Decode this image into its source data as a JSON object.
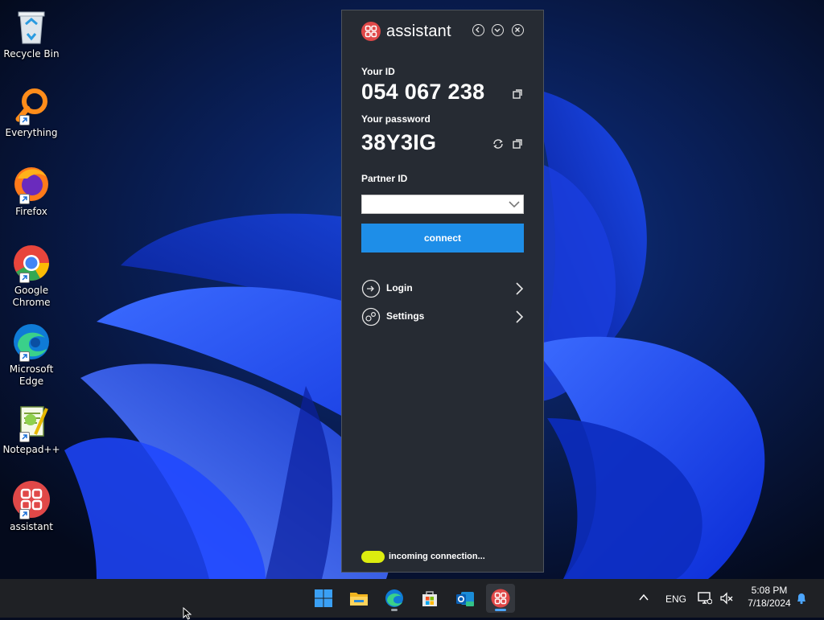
{
  "desktop": {
    "icons": [
      {
        "label": "Recycle Bin",
        "icon": "recycle-bin-icon"
      },
      {
        "label": "Everything",
        "icon": "everything-search-icon"
      },
      {
        "label": "Firefox",
        "icon": "firefox-icon"
      },
      {
        "label": "Google Chrome",
        "icon": "chrome-icon"
      },
      {
        "label": "Microsoft Edge",
        "icon": "edge-icon"
      },
      {
        "label": "Notepad++",
        "icon": "notepad-plus-plus-icon"
      },
      {
        "label": "assistant",
        "icon": "assistant-icon"
      }
    ]
  },
  "assistant": {
    "title": "assistant",
    "your_id_label": "Your ID",
    "your_id": "054 067 238",
    "your_password_label": "Your password",
    "your_password": "38Y3IG",
    "partner_id_label": "Partner ID",
    "partner_id_value": "",
    "connect_label": "connect",
    "menu": [
      {
        "label": "Login",
        "icon": "login-icon"
      },
      {
        "label": "Settings",
        "icon": "settings-icon"
      }
    ],
    "status_text": "incoming connection...",
    "status_color": "#dced0f",
    "accent_color": "#1e8ee8"
  },
  "taskbar": {
    "apps": [
      "windows-start-icon",
      "file-explorer-icon",
      "edge-icon",
      "microsoft-store-icon",
      "outlook-new-icon",
      "assistant-icon"
    ],
    "language": "ENG",
    "time": "5:08 PM",
    "date": "7/18/2024"
  }
}
